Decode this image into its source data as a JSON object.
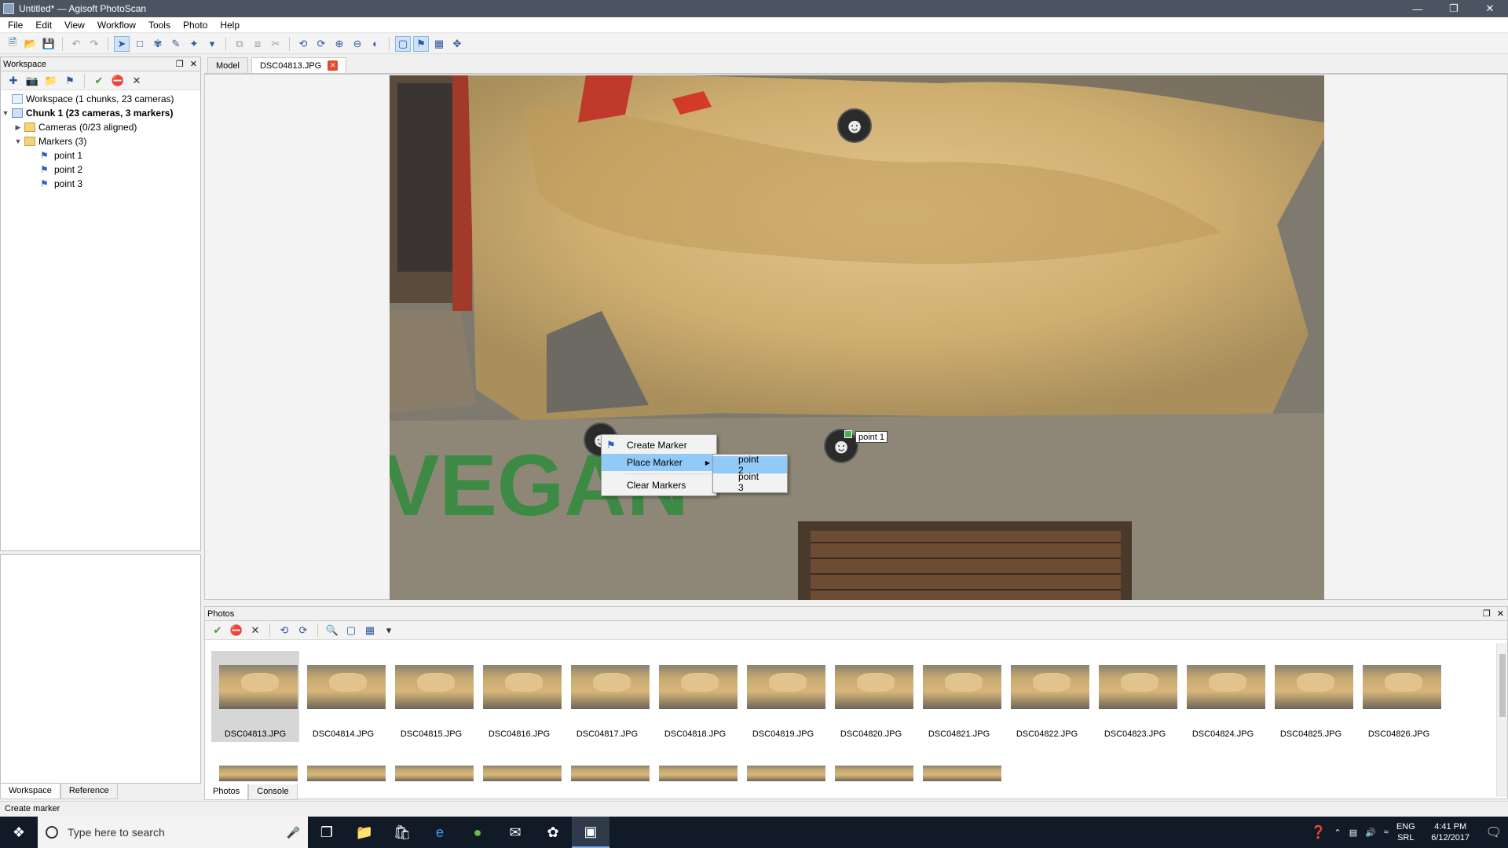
{
  "window": {
    "title": "Untitled* — Agisoft PhotoScan"
  },
  "menu": [
    "File",
    "Edit",
    "View",
    "Workflow",
    "Tools",
    "Photo",
    "Help"
  ],
  "workspace": {
    "header": "Workspace",
    "tree": {
      "root": "Workspace (1 chunks, 23 cameras)",
      "chunk": "Chunk 1 (23 cameras, 3 markers)",
      "cameras": "Cameras (0/23 aligned)",
      "markers": "Markers (3)",
      "marker_items": [
        "point 1",
        "point 2",
        "point 3"
      ]
    },
    "bottom_tabs": [
      "Workspace",
      "Reference"
    ]
  },
  "doc_tabs": {
    "model": "Model",
    "photo": "DSC04813.JPG"
  },
  "photo_view": {
    "marker_label": "point 1",
    "graffiti": "VEGAN"
  },
  "context_menu": {
    "items": [
      "Create Marker",
      "Place Marker",
      "Clear Markers"
    ],
    "submenu": [
      "point 2",
      "point 3"
    ]
  },
  "photos": {
    "header": "Photos",
    "row1": [
      "DSC04813.JPG",
      "DSC04814.JPG",
      "DSC04815.JPG",
      "DSC04816.JPG",
      "DSC04817.JPG",
      "DSC04818.JPG",
      "DSC04819.JPG",
      "DSC04820.JPG",
      "DSC04821.JPG",
      "DSC04822.JPG",
      "DSC04823.JPG",
      "DSC04824.JPG",
      "DSC04825.JPG",
      "DSC04826.JPG"
    ],
    "bottom_tabs": [
      "Photos",
      "Console"
    ]
  },
  "status": "Create marker",
  "taskbar": {
    "search_placeholder": "Type here to search",
    "lang": "ENG",
    "layout": "SRL",
    "time": "4:41 PM",
    "date": "6/12/2017"
  }
}
